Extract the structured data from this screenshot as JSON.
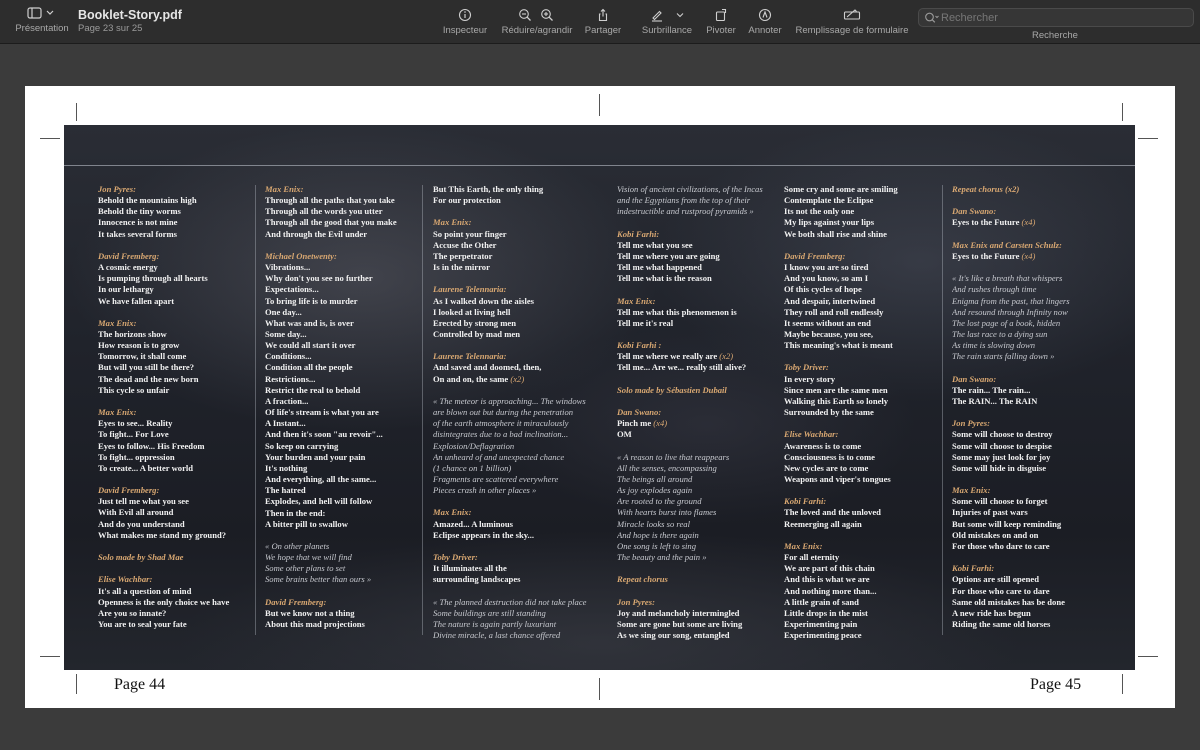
{
  "toolbar": {
    "view_label": "Présentation",
    "doc_title": "Booklet-Story.pdf",
    "doc_subtitle": "Page 23 sur 25",
    "inspector_label": "Inspecteur",
    "zoom_label": "Réduire/agrandir",
    "share_label": "Partager",
    "highlight_label": "Surbrillance",
    "rotate_label": "Pivoter",
    "annotate_label": "Annoter",
    "form_fill_label": "Remplissage de formulaire",
    "search_placeholder": "Rechercher",
    "search_label": "Recherche",
    "icons": [
      "sidebar-icon",
      "chevron-down-icon",
      "info-icon",
      "zoom-out-icon",
      "zoom-in-icon",
      "share-icon",
      "highlighter-icon",
      "rotate-icon",
      "markup-icon",
      "form-icon",
      "search-icon"
    ]
  },
  "pages": {
    "left_number": "Page 44",
    "right_number": "Page 45"
  },
  "columns": [
    [
      {
        "t": "Jon Pyres:",
        "s": "spk"
      },
      {
        "t": "Behold the mountains high"
      },
      {
        "t": "Behold the tiny worms"
      },
      {
        "t": "Innocence is not mine"
      },
      {
        "t": "It takes several forms"
      },
      {
        "t": "",
        "s": "gap"
      },
      {
        "t": "David Fremberg:",
        "s": "spk"
      },
      {
        "t": "A cosmic energy"
      },
      {
        "t": "Is pumping through all hearts"
      },
      {
        "t": "In our lethargy"
      },
      {
        "t": "We have fallen apart"
      },
      {
        "t": "",
        "s": "gap"
      },
      {
        "t": "Max Enix:",
        "s": "spk"
      },
      {
        "t": "The horizons show"
      },
      {
        "t": "How reason is to grow"
      },
      {
        "t": "Tomorrow, it shall come"
      },
      {
        "t": "But will you still be there?"
      },
      {
        "t": "The dead and the new born"
      },
      {
        "t": "This cycle so unfair"
      },
      {
        "t": "",
        "s": "gap"
      },
      {
        "t": "Max Enix:",
        "s": "spk"
      },
      {
        "t": "Eyes to see... Reality"
      },
      {
        "t": "To fight... For Love"
      },
      {
        "t": "Eyes to follow... His Freedom"
      },
      {
        "t": "To fight... oppression"
      },
      {
        "t": "To create... A better world"
      },
      {
        "t": "",
        "s": "gap"
      },
      {
        "t": "David Fremberg:",
        "s": "spk"
      },
      {
        "t": "Just tell me what you see"
      },
      {
        "t": "With Evil all around"
      },
      {
        "t": "And do you understand"
      },
      {
        "t": "What makes me stand my ground?"
      },
      {
        "t": "",
        "s": "gap"
      },
      {
        "t": "Solo made by Shad Mae",
        "s": "spk"
      },
      {
        "t": "",
        "s": "gap"
      },
      {
        "t": "Elise Wachbar:",
        "s": "spk"
      },
      {
        "t": "It's all a question of mind"
      },
      {
        "t": "Openness is the only choice we have"
      },
      {
        "t": "Are you so innate?"
      },
      {
        "t": "You are to seal your fate"
      }
    ],
    [
      {
        "t": "Max Enix:",
        "s": "spk"
      },
      {
        "t": "Through all the paths that you take"
      },
      {
        "t": "Through all the words you utter"
      },
      {
        "t": "Through all the good that you make"
      },
      {
        "t": "And through the Evil under"
      },
      {
        "t": "",
        "s": "gap"
      },
      {
        "t": "Michael Onetwenty:",
        "s": "spk"
      },
      {
        "t": "Vibrations..."
      },
      {
        "t": "Why don't you see no further"
      },
      {
        "t": "Expectations..."
      },
      {
        "t": "To bring life is to murder"
      },
      {
        "t": "One day..."
      },
      {
        "t": "What was and is, is over"
      },
      {
        "t": "Some day..."
      },
      {
        "t": "We could all start it over"
      },
      {
        "t": "Conditions..."
      },
      {
        "t": "Condition all the people"
      },
      {
        "t": "Restrictions..."
      },
      {
        "t": "Restrict the real to behold"
      },
      {
        "t": "A fraction..."
      },
      {
        "t": "Of life's stream is what you are"
      },
      {
        "t": "A Instant..."
      },
      {
        "t": "And then it's soon \"au revoir\"..."
      },
      {
        "t": "So keep on carrying"
      },
      {
        "t": "Your burden and your pain"
      },
      {
        "t": "It's nothing"
      },
      {
        "t": "And everything, all the same..."
      },
      {
        "t": "The hatred"
      },
      {
        "t": "Explodes, and hell will follow"
      },
      {
        "t": "Then in the end:"
      },
      {
        "t": "A bitter pill to swallow"
      },
      {
        "t": "",
        "s": "gap"
      },
      {
        "t": "« On other planets",
        "s": "it"
      },
      {
        "t": "We hope that we will find",
        "s": "it"
      },
      {
        "t": "Some other plans to set",
        "s": "it"
      },
      {
        "t": "Some brains better than ours »",
        "s": "it"
      },
      {
        "t": "",
        "s": "gap"
      },
      {
        "t": "David Fremberg:",
        "s": "spk"
      },
      {
        "t": "But we know not a thing"
      },
      {
        "t": "About this mad projections"
      }
    ],
    [
      {
        "t": "But This Earth, the only thing"
      },
      {
        "t": "For our protection"
      },
      {
        "t": "",
        "s": "gap"
      },
      {
        "t": "Max Enix:",
        "s": "spk"
      },
      {
        "t": "So point your finger"
      },
      {
        "t": "Accuse the Other"
      },
      {
        "t": "The perpetrator"
      },
      {
        "t": "Is in the mirror"
      },
      {
        "t": "",
        "s": "gap"
      },
      {
        "t": "Laurene Telennaria:",
        "s": "spk"
      },
      {
        "t": "As I walked down the aisles"
      },
      {
        "t": "I looked at living hell"
      },
      {
        "t": "Erected by strong men"
      },
      {
        "t": "Controlled by mad men"
      },
      {
        "t": "",
        "s": "gap"
      },
      {
        "t": "Laurene Telennaria:",
        "s": "spk"
      },
      {
        "t": "And saved and doomed, then,"
      },
      {
        "t": "On and on, the same",
        "x": "(x2)"
      },
      {
        "t": "",
        "s": "gap"
      },
      {
        "t": "« The meteor is approaching... The windows",
        "s": "it"
      },
      {
        "t": "are blown out but during the penetration",
        "s": "it"
      },
      {
        "t": "of the earth atmosphere it miraculously",
        "s": "it"
      },
      {
        "t": "disintegrates due to a bad inclination...",
        "s": "it"
      },
      {
        "t": "Explosion/Deflagration",
        "s": "it"
      },
      {
        "t": "An unheard of and unexpected chance",
        "s": "it"
      },
      {
        "t": "(1 chance on 1 billion)",
        "s": "it"
      },
      {
        "t": "Fragments are scattered everywhere",
        "s": "it"
      },
      {
        "t": "Pieces crash in other places »",
        "s": "it"
      },
      {
        "t": "",
        "s": "gap"
      },
      {
        "t": "Max Enix:",
        "s": "spk"
      },
      {
        "t": "Amazed... A luminous"
      },
      {
        "t": "Eclipse appears in the sky..."
      },
      {
        "t": "",
        "s": "gap"
      },
      {
        "t": "Toby Driver:",
        "s": "spk"
      },
      {
        "t": "It illuminates all the"
      },
      {
        "t": "surrounding landscapes"
      },
      {
        "t": "",
        "s": "gap"
      },
      {
        "t": "« The planned destruction did not take place",
        "s": "it"
      },
      {
        "t": "Some buildings are still standing",
        "s": "it"
      },
      {
        "t": "The nature is again partly luxuriant",
        "s": "it"
      },
      {
        "t": "Divine miracle, a last chance offered",
        "s": "it"
      }
    ],
    [
      {
        "t": "Vision of ancient civilizations, of the Incas",
        "s": "it"
      },
      {
        "t": "and the Egyptians from the top of their",
        "s": "it"
      },
      {
        "t": "indestructible and rustproof pyramids »",
        "s": "it"
      },
      {
        "t": "",
        "s": "gap"
      },
      {
        "t": "Kobi Farhi:",
        "s": "spk"
      },
      {
        "t": "Tell me what you see"
      },
      {
        "t": "Tell me where you are going"
      },
      {
        "t": "Tell me what happened"
      },
      {
        "t": "Tell me what is the reason"
      },
      {
        "t": "",
        "s": "gap"
      },
      {
        "t": "Max Enix:",
        "s": "spk"
      },
      {
        "t": "Tell me what this phenomenon is"
      },
      {
        "t": "Tell me it's real"
      },
      {
        "t": "",
        "s": "gap"
      },
      {
        "t": "Kobi Farhi :",
        "s": "spk"
      },
      {
        "t": "Tell me where we really are",
        "x": "(x2)"
      },
      {
        "t": "Tell me... Are we... really still alive?"
      },
      {
        "t": "",
        "s": "gap"
      },
      {
        "t": "Solo made by Sébastien Dubail",
        "s": "spk"
      },
      {
        "t": "",
        "s": "gap"
      },
      {
        "t": "Dan Swano:",
        "s": "spk"
      },
      {
        "t": "Pinch me",
        "x": "(x4)"
      },
      {
        "t": "OM"
      },
      {
        "t": "",
        "s": "gap"
      },
      {
        "t": "« A reason to live that reappears",
        "s": "it"
      },
      {
        "t": "All the senses, encompassing",
        "s": "it"
      },
      {
        "t": "The beings all around",
        "s": "it"
      },
      {
        "t": "As joy explodes again",
        "s": "it"
      },
      {
        "t": "Are rooted to the ground",
        "s": "it"
      },
      {
        "t": "With hearts burst into flames",
        "s": "it"
      },
      {
        "t": "Miracle looks so real",
        "s": "it"
      },
      {
        "t": "And hope is there again",
        "s": "it"
      },
      {
        "t": "One song is left to sing",
        "s": "it"
      },
      {
        "t": "The beauty and the pain »",
        "s": "it"
      },
      {
        "t": "",
        "s": "gap"
      },
      {
        "t": "Repeat chorus",
        "s": "spk"
      },
      {
        "t": "",
        "s": "gap"
      },
      {
        "t": "Jon Pyres:",
        "s": "spk"
      },
      {
        "t": "Joy and melancholy intermingled"
      },
      {
        "t": "Some are gone but some are living"
      },
      {
        "t": "As we sing our song, entangled"
      }
    ],
    [
      {
        "t": "Some cry and some are smiling"
      },
      {
        "t": "Contemplate the Eclipse"
      },
      {
        "t": "Its not the only one"
      },
      {
        "t": "My lips against your lips"
      },
      {
        "t": "We both shall rise and shine"
      },
      {
        "t": "",
        "s": "gap"
      },
      {
        "t": "David Fremberg:",
        "s": "spk"
      },
      {
        "t": "I know you are so tired"
      },
      {
        "t": "And you know, so am I"
      },
      {
        "t": "Of this cycles of hope"
      },
      {
        "t": "And despair, intertwined"
      },
      {
        "t": "They roll and roll endlessly"
      },
      {
        "t": "It seems without an end"
      },
      {
        "t": "Maybe because, you see,"
      },
      {
        "t": "This meaning's what is meant"
      },
      {
        "t": "",
        "s": "gap"
      },
      {
        "t": "Toby Driver:",
        "s": "spk"
      },
      {
        "t": "In every story"
      },
      {
        "t": "Since men are the same men"
      },
      {
        "t": "Walking this Earth so lonely"
      },
      {
        "t": "Surrounded by the same"
      },
      {
        "t": "",
        "s": "gap"
      },
      {
        "t": "Elise Wachbar:",
        "s": "spk"
      },
      {
        "t": "Awareness is to come"
      },
      {
        "t": "Consciousness is to come"
      },
      {
        "t": "New cycles are to come"
      },
      {
        "t": "Weapons and viper's tongues"
      },
      {
        "t": "",
        "s": "gap"
      },
      {
        "t": "Kobi Farhi:",
        "s": "spk"
      },
      {
        "t": "The loved and the unloved"
      },
      {
        "t": "Reemerging all again"
      },
      {
        "t": "",
        "s": "gap"
      },
      {
        "t": "Max Enix:",
        "s": "spk"
      },
      {
        "t": "For all eternity"
      },
      {
        "t": "We are part of this chain"
      },
      {
        "t": "And this is what we are"
      },
      {
        "t": "And nothing more than..."
      },
      {
        "t": "A little grain of sand"
      },
      {
        "t": "Little drops in the mist"
      },
      {
        "t": "Experimenting pain"
      },
      {
        "t": "Experimenting peace"
      }
    ],
    [
      {
        "t": "Repeat chorus (x2)",
        "s": "spk"
      },
      {
        "t": "",
        "s": "gap"
      },
      {
        "t": "Dan Swano:",
        "s": "spk"
      },
      {
        "t": "Eyes to the Future",
        "x": "(x4)"
      },
      {
        "t": "",
        "s": "gap"
      },
      {
        "t": "Max Enix and Carsten Schulz:",
        "s": "spk"
      },
      {
        "t": "Eyes to the Future",
        "x": "(x4)"
      },
      {
        "t": "",
        "s": "gap"
      },
      {
        "t": "« It's like a breath that whispers",
        "s": "it"
      },
      {
        "t": "And rushes through time",
        "s": "it"
      },
      {
        "t": "Enigma from the past, that lingers",
        "s": "it"
      },
      {
        "t": "And resound through Infinity now",
        "s": "it"
      },
      {
        "t": "The lost page of a book, hidden",
        "s": "it"
      },
      {
        "t": "The last race to a dying sun",
        "s": "it"
      },
      {
        "t": "As time is slowing down",
        "s": "it"
      },
      {
        "t": "The rain starts falling down »",
        "s": "it"
      },
      {
        "t": "",
        "s": "gap"
      },
      {
        "t": "Dan Swano:",
        "s": "spk"
      },
      {
        "t": "The rain... The rain..."
      },
      {
        "t": "The RAIN... The RAIN"
      },
      {
        "t": "",
        "s": "gap"
      },
      {
        "t": "Jon Pyres:",
        "s": "spk"
      },
      {
        "t": "Some will choose to destroy"
      },
      {
        "t": "Some will choose to despise"
      },
      {
        "t": "Some may just look for joy"
      },
      {
        "t": "Some will hide in disguise"
      },
      {
        "t": "",
        "s": "gap"
      },
      {
        "t": "Max Enix:",
        "s": "spk"
      },
      {
        "t": "Some will choose to forget"
      },
      {
        "t": "Injuries of past wars"
      },
      {
        "t": "But some will keep reminding"
      },
      {
        "t": "Old mistakes on and on"
      },
      {
        "t": "For those who dare to care"
      },
      {
        "t": "",
        "s": "gap"
      },
      {
        "t": "Kobi Farhi:",
        "s": "spk"
      },
      {
        "t": "Options are still opened"
      },
      {
        "t": "For those who care to dare"
      },
      {
        "t": "Same old mistakes has be done"
      },
      {
        "t": "A new ride has begun"
      },
      {
        "t": "Riding the same old horses"
      }
    ]
  ]
}
